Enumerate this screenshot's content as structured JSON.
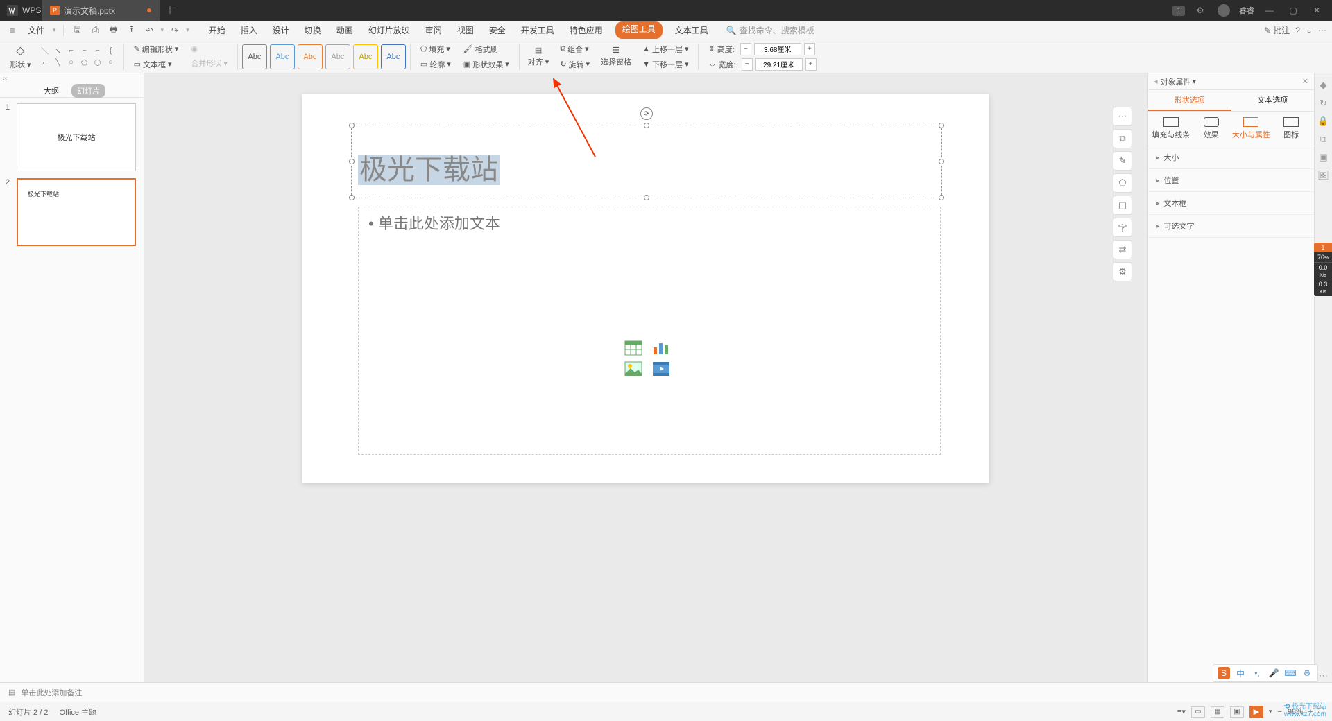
{
  "titlebar": {
    "app": "WPS",
    "doc": "演示文稿.pptx",
    "badge": "1",
    "user": "睿睿"
  },
  "menubar": {
    "file": "文件",
    "tabs": [
      "开始",
      "插入",
      "设计",
      "切换",
      "动画",
      "幻灯片放映",
      "审阅",
      "视图",
      "安全",
      "开发工具",
      "特色应用",
      "绘图工具",
      "文本工具"
    ],
    "active_tab": "绘图工具",
    "search": "查找命令、搜索模板",
    "annot": "批注"
  },
  "ribbon": {
    "shape": "形状",
    "edit_shape": "编辑形状",
    "textbox": "文本框",
    "merge_shape": "合并形状",
    "abc": "Abc",
    "fill": "填充",
    "outline": "轮廓",
    "format_brush": "格式刷",
    "shape_fx": "形状效果",
    "align": "对齐",
    "rotate": "旋转",
    "group": "组合",
    "sel_pane": "选择窗格",
    "bring_fwd": "上移一层",
    "send_back": "下移一层",
    "height_lbl": "高度:",
    "height_val": "3.68厘米",
    "width_lbl": "宽度:",
    "width_val": "29.21厘米"
  },
  "left_panel": {
    "outline": "大纲",
    "slides": "幻灯片",
    "t1": "极光下载站",
    "t2": "极光下载站"
  },
  "slide": {
    "title": "极光下载站",
    "body": "单击此处添加文本"
  },
  "right_panel": {
    "header": "对象属性",
    "tabs": [
      "形状选项",
      "文本选项"
    ],
    "subtabs": [
      "填充与线条",
      "效果",
      "大小与属性",
      "图标"
    ],
    "sections": [
      "大小",
      "位置",
      "文本框",
      "可选文字"
    ]
  },
  "notes": "单击此处添加备注",
  "status": {
    "slide": "幻灯片 2 / 2",
    "theme": "Office 主题",
    "zoom": "98%"
  },
  "perf": {
    "n": "1",
    "p": "76",
    "s1": "0.0",
    "u1": "K/s",
    "s2": "0.3",
    "u2": "K/s"
  },
  "ime": {
    "lang": "中"
  },
  "watermark": {
    "name": "极光下载站",
    "url": "www.xz7.com"
  }
}
